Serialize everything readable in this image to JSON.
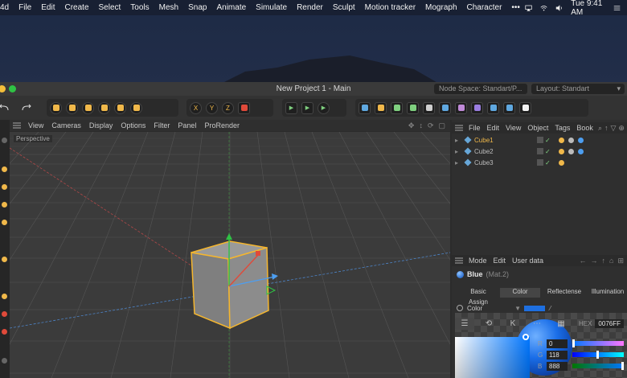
{
  "menubar": {
    "app_fragment": "4d",
    "items": [
      "File",
      "Edit",
      "Create",
      "Select",
      "Tools",
      "Mesh",
      "Snap",
      "Animate",
      "Simulate",
      "Render",
      "Sculpt",
      "Motion tracker",
      "Mograph",
      "Character",
      "•••"
    ],
    "clock": "Tue 9:41 AM"
  },
  "window": {
    "title": "New Project 1 - Main",
    "node_space": "Node Space: Standart/P...",
    "layout": "Layout: Standart"
  },
  "viewport": {
    "menu": [
      "View",
      "Cameras",
      "Display",
      "Options",
      "Filter",
      "Panel",
      "ProRender"
    ],
    "label": "Perspective"
  },
  "object_manager": {
    "menu": [
      "File",
      "Edit",
      "View",
      "Object",
      "Tags",
      "Book"
    ],
    "objects": [
      {
        "name": "Cube1",
        "selected": true
      },
      {
        "name": "Cube2",
        "selected": false
      },
      {
        "name": "Cube3",
        "selected": false
      }
    ]
  },
  "attributes": {
    "menu": [
      "Mode",
      "Edit",
      "User data"
    ],
    "material_name": "Blue",
    "material_id": "(Mat.2)",
    "tabs": [
      "Basic",
      "Color",
      "Reflectense",
      "Illumination",
      "Assign"
    ],
    "active_tab": "Color",
    "color_label": "Color",
    "hex_label": "HEX",
    "hex_value": "0076FF",
    "r_label": "R",
    "r_value": "0",
    "g_label": "G",
    "g_value": "118",
    "b_label": "B",
    "b_value": "888",
    "accent_color": "#0076ff"
  }
}
